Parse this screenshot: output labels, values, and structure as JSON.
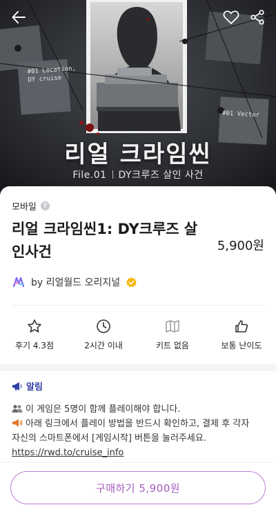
{
  "hero": {
    "title": "리얼 크라임씬",
    "subtitle_left": "File.01",
    "subtitle_right": "DY크루즈 살인 사건",
    "note1_text": "#01 Location, DY cruise",
    "note2_text": "#01 Vector"
  },
  "header": {
    "back_icon": "arrow-left-icon",
    "like_icon": "heart-icon",
    "share_icon": "share-icon"
  },
  "product": {
    "platform": "모바일",
    "title": "리얼 크라임씬1: DY크루즈 살인사건",
    "price": "5,900원",
    "creator": "by 리얼월드 오리지널"
  },
  "stats": [
    {
      "icon": "star-icon",
      "label": "후기 4.3점"
    },
    {
      "icon": "clock-icon",
      "label": "2시간 이내"
    },
    {
      "icon": "map-icon",
      "label": "키트 없음"
    },
    {
      "icon": "thumbs-up-icon",
      "label": "보통 난이도"
    }
  ],
  "notice": {
    "heading": "알림",
    "line1": "이 게임은 5명이 함께 플레이해야 합니다.",
    "line2": "아래 링크에서 플레이 방법을 반드시 확인하고, 결제 후 각자",
    "line3": "자신의 스마트폰에서 [게임시작] 버튼을 눌러주세요.",
    "link": "https://rwd.to/cruise_info"
  },
  "cta": {
    "buy_label": "구매하기 5,900원"
  },
  "colors": {
    "accent": "#a35bbf",
    "notice_blue": "#2f3fa6",
    "verified": "#f5b700"
  }
}
